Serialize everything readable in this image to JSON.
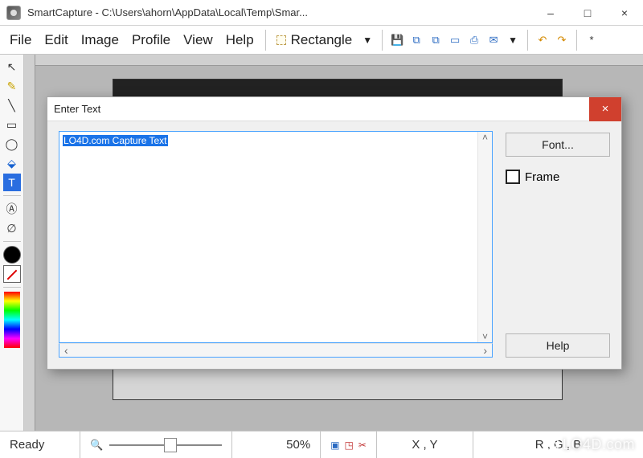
{
  "window": {
    "title": "SmartCapture - C:\\Users\\ahorn\\AppData\\Local\\Temp\\Smar...",
    "buttons": {
      "minimize": "–",
      "maximize": "□",
      "close": "×"
    }
  },
  "menu": {
    "file": "File",
    "edit": "Edit",
    "image": "Image",
    "profile": "Profile",
    "view": "View",
    "help": "Help"
  },
  "capture_toolbar": {
    "mode_label": "Rectangle",
    "dropdown_glyph": "▼",
    "star": "*"
  },
  "tool_palette": {
    "selected_index": 5
  },
  "dialog": {
    "title": "Enter Text",
    "text_value": "LO4D.com Capture Text",
    "font_button": "Font...",
    "frame_label": "Frame",
    "frame_checked": false,
    "help_button": "Help"
  },
  "statusbar": {
    "ready": "Ready",
    "zoom_percent": "50%",
    "coords": "X , Y",
    "rgb": "R , G , B"
  },
  "watermark": "LO4D.com"
}
